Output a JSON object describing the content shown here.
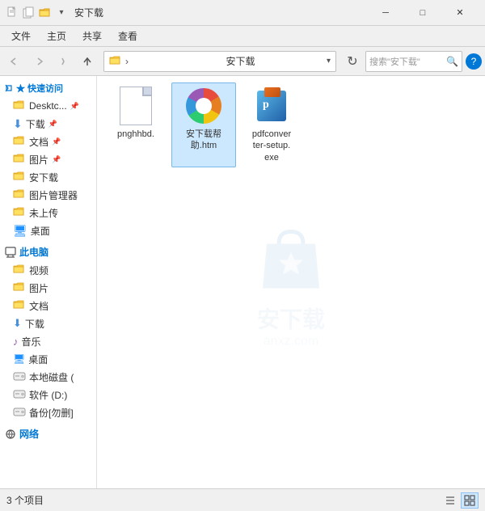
{
  "titleBar": {
    "title": "安下载",
    "icons": [
      "file-new",
      "folder-open",
      "save"
    ],
    "controls": [
      "minimize",
      "maximize",
      "close"
    ]
  },
  "menuBar": {
    "items": [
      "文件",
      "主页",
      "共享",
      "查看"
    ]
  },
  "toolbar": {
    "back": "←",
    "forward": "→",
    "up": "↑",
    "addressLabel": "安下载",
    "addressPath": "安下载",
    "searchPlaceholder": "搜索\"安下载\"",
    "refreshLabel": "↻"
  },
  "sidebar": {
    "quickAccess": {
      "label": "快速访问",
      "items": [
        {
          "name": "Desktc...",
          "icon": "folder",
          "pinned": true
        },
        {
          "name": "下载",
          "icon": "folder-download",
          "pinned": true
        },
        {
          "name": "文档",
          "icon": "folder-doc",
          "pinned": true
        },
        {
          "name": "图片",
          "icon": "folder-pic",
          "pinned": true
        },
        {
          "name": "安下载",
          "icon": "folder"
        },
        {
          "name": "图片管理器",
          "icon": "folder"
        },
        {
          "name": "未上传",
          "icon": "folder"
        },
        {
          "name": "桌面",
          "icon": "folder"
        }
      ]
    },
    "thisPC": {
      "label": "此电脑",
      "items": [
        {
          "name": "视频",
          "icon": "folder-video"
        },
        {
          "name": "图片",
          "icon": "folder-pic"
        },
        {
          "name": "文档",
          "icon": "folder-doc"
        },
        {
          "name": "下载",
          "icon": "folder-download"
        },
        {
          "name": "音乐",
          "icon": "folder-music"
        },
        {
          "name": "桌面",
          "icon": "folder-desktop"
        },
        {
          "name": "本地磁盘 (",
          "icon": "drive-local"
        },
        {
          "name": "软件 (D:)",
          "icon": "drive-software"
        },
        {
          "name": "备份[勿删]",
          "icon": "drive-backup"
        }
      ]
    },
    "network": {
      "label": "网络"
    }
  },
  "files": [
    {
      "name": "pnghhbd.",
      "type": "blank",
      "selected": false
    },
    {
      "name": "安下载帮助.htm",
      "type": "html",
      "selected": true
    },
    {
      "name": "pdfconverter-setup.exe",
      "type": "exe",
      "selected": false
    }
  ],
  "statusBar": {
    "count": "3 个项目",
    "selected": ""
  },
  "watermark": {
    "text": "安下载",
    "subtext": "anxz.com"
  }
}
